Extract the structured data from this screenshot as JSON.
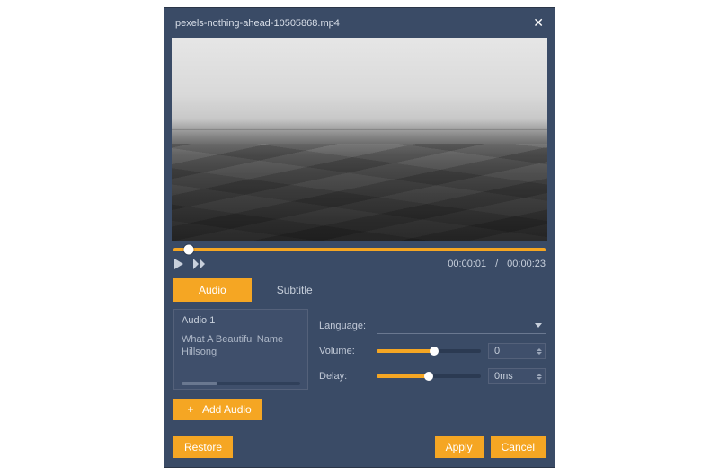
{
  "titlebar": {
    "filename": "pexels-nothing-ahead-10505868.mp4"
  },
  "playback": {
    "current_time": "00:00:01",
    "duration": "00:00:23",
    "separator": "/",
    "progress_pct": 4
  },
  "tabs": {
    "audio": "Audio",
    "subtitle": "Subtitle",
    "active": "audio"
  },
  "audio_list": {
    "items": [
      {
        "label": "Audio 1"
      },
      {
        "label": "What A Beautiful Name  Hillsong"
      }
    ]
  },
  "controls": {
    "language_label": "Language:",
    "language_value": "",
    "volume_label": "Volume:",
    "volume_value": "0",
    "volume_pct": 55,
    "delay_label": "Delay:",
    "delay_value": "0ms",
    "delay_pct": 50
  },
  "buttons": {
    "add_audio": "Add Audio",
    "restore": "Restore",
    "apply": "Apply",
    "cancel": "Cancel"
  },
  "colors": {
    "accent": "#f5a623",
    "bg": "#3a4b66"
  }
}
